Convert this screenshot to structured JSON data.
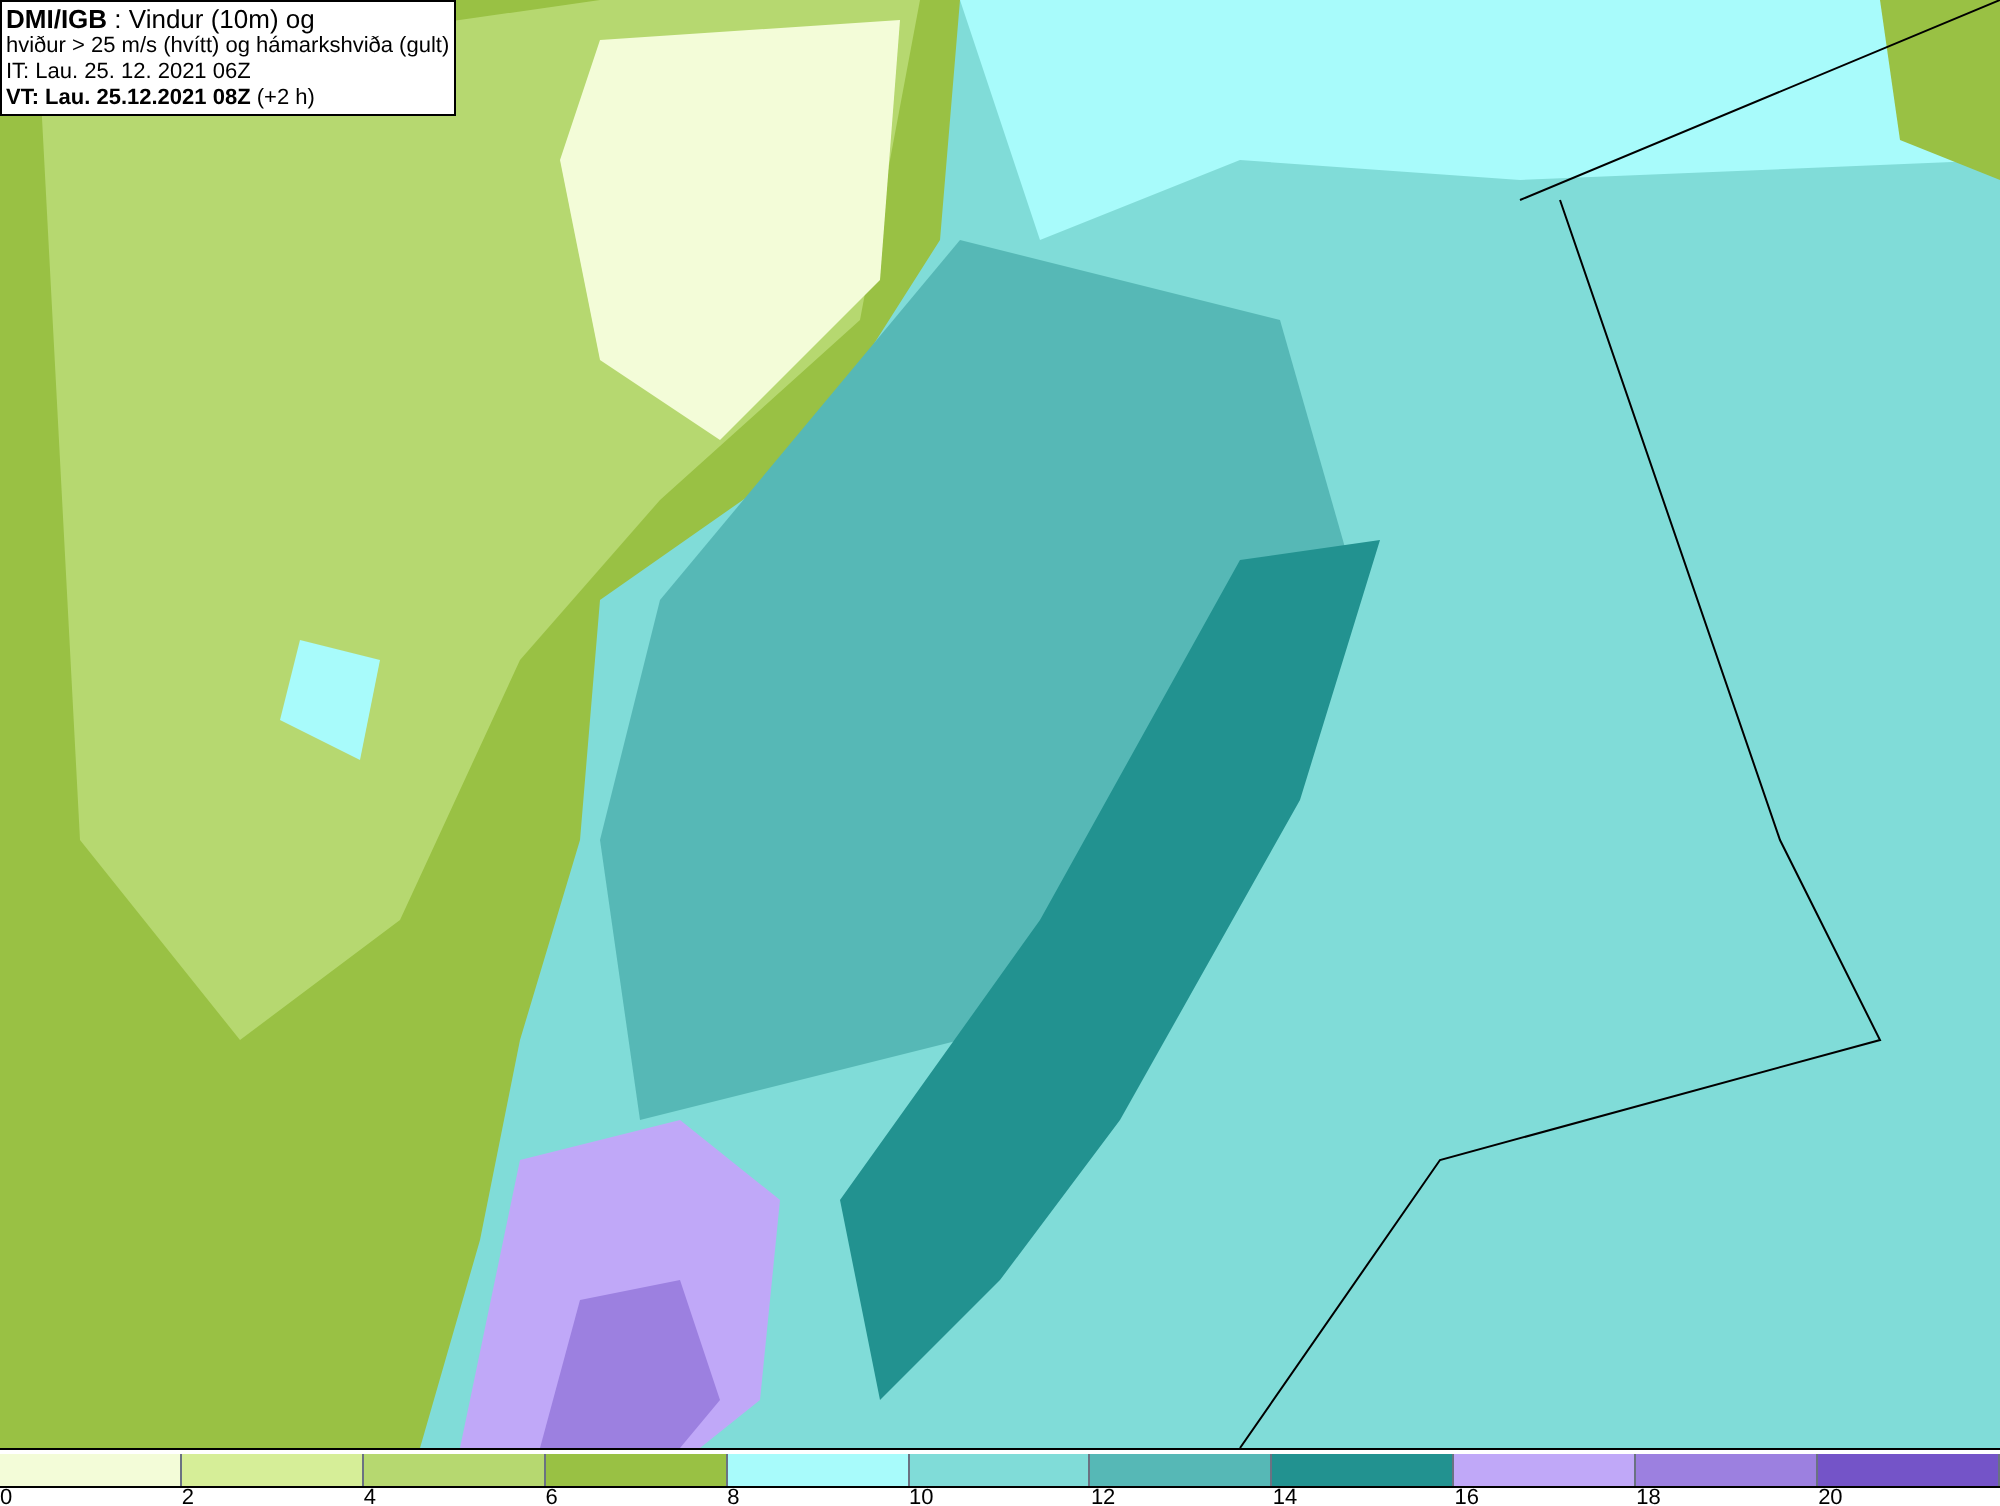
{
  "title_box": {
    "lines": [
      "**DMI/IGB** : Vindur (10m) og",
      "hviður > 25 m/s (hvítt) og hámarkshviða (gult)",
      "IT: Lau. 25. 12. 2021 06Z",
      "**VT: Lau. 25.12.2021 08Z** (+2 h)"
    ]
  },
  "legend": {
    "segments": [
      {
        "label": "0",
        "color": "#f3fcd8"
      },
      {
        "label": "2",
        "color": "#d6ee98"
      },
      {
        "label": "4",
        "color": "#b6d870"
      },
      {
        "label": "6",
        "color": "#99c144"
      },
      {
        "label": "8",
        "color": "#a8fbfb"
      },
      {
        "label": "10",
        "color": "#80dcd8"
      },
      {
        "label": "12",
        "color": "#56b8b6"
      },
      {
        "label": "14",
        "color": "#229290"
      },
      {
        "label": "16",
        "color": "#c0a8f8"
      },
      {
        "label": "18",
        "color": "#9c80e0"
      },
      {
        "label": "20",
        "color": "#7454c8"
      }
    ]
  }
}
